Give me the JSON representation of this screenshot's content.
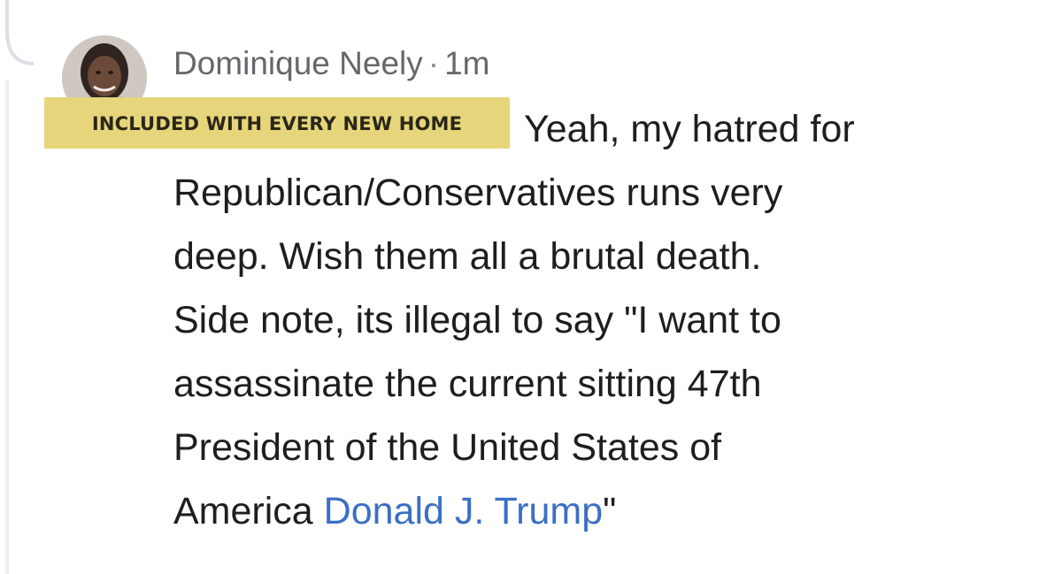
{
  "comment": {
    "author": "Dominique Neely",
    "separator": "·",
    "time": "1m",
    "overlay_label": "INCLUDED WITH EVERY NEW HOME",
    "lines": [
      "Yeah, my hatred for",
      "Republican/Conservatives runs very",
      "deep. Wish them all a brutal death.",
      "Side note, its illegal to say \"I want to",
      "assassinate the current sitting 47th",
      "President of the United States of"
    ],
    "last_line_prefix": "America ",
    "mention": "Donald J. Trump",
    "last_line_suffix": "\""
  },
  "colors": {
    "mention": "#3b6fc6",
    "overlay_bg": "#e6d57a",
    "text": "#1c1e21",
    "meta": "#65676b"
  },
  "icons": {
    "avatar": "profile-photo",
    "thread": "reply-thread-line"
  }
}
